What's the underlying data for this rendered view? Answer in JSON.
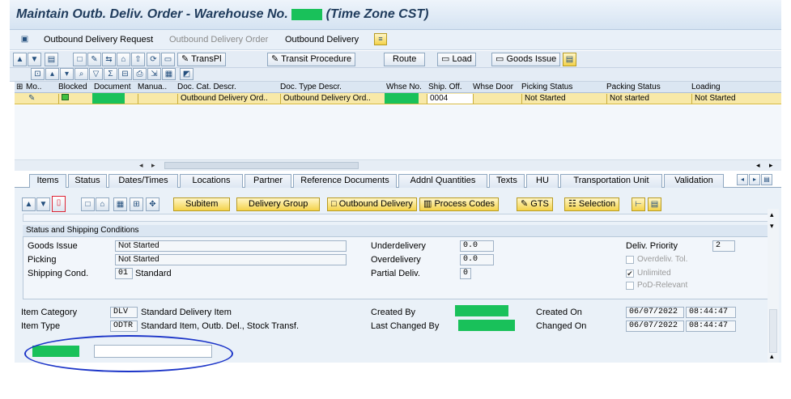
{
  "window": {
    "title_prefix": "Maintain Outb. Deliv. Order - Warehouse No.",
    "title_suffix": "(Time Zone CST)"
  },
  "menu": {
    "items": [
      {
        "label": "Outbound Delivery Request",
        "disabled": false
      },
      {
        "label": "Outbound Delivery Order",
        "disabled": true
      },
      {
        "label": "Outbound Delivery",
        "disabled": false
      }
    ]
  },
  "toolbar": {
    "transpl": "TransPl",
    "transit": "Transit Procedure",
    "route": "Route",
    "load": "Load",
    "goods_issue": "Goods Issue"
  },
  "grid": {
    "columns": [
      "Mo..",
      "Blocked",
      "Document",
      "Manua..",
      "Doc. Cat. Descr.",
      "Doc. Type Descr.",
      "Whse No.",
      "Ship. Off.",
      "Whse Door",
      "Picking Status",
      "Packing Status",
      "Loading"
    ],
    "row": {
      "doc_cat": "Outbound Delivery Ord..",
      "doc_type": "Outbound Delivery Ord..",
      "ship_off": "0004",
      "picking": "Not Started",
      "packing": "Not started",
      "loading": "Not Started"
    }
  },
  "tabs": [
    "Items",
    "Status",
    "Dates/Times",
    "Locations",
    "Partner",
    "Reference Documents",
    "Addnl Quantities",
    "Texts",
    "HU",
    "Transportation Unit",
    "Validation"
  ],
  "item_toolbar": {
    "subitem": "Subitem",
    "delivery_group": "Delivery Group",
    "outbound_delivery": "Outbound Delivery",
    "process_codes": "Process Codes",
    "gts": "GTS",
    "selection": "Selection"
  },
  "section": {
    "title": "Status and Shipping Conditions",
    "goods_issue_label": "Goods Issue",
    "goods_issue_value": "Not Started",
    "picking_label": "Picking",
    "picking_value": "Not Started",
    "shipping_label": "Shipping Cond.",
    "shipping_code": "01",
    "shipping_text": "Standard",
    "underdelivery_label": "Underdelivery",
    "underdelivery_value": "0.0",
    "overdelivery_label": "Overdelivery",
    "overdelivery_value": "0.0",
    "partial_label": "Partial Deliv.",
    "partial_value": "0",
    "priority_label": "Deliv. Priority",
    "priority_value": "2",
    "overdeliv_tol": "Overdeliv. Tol.",
    "unlimited": "Unlimited",
    "pod": "PoD-Relevant"
  },
  "item": {
    "category_label": "Item Category",
    "category_code": "DLV",
    "category_text": "Standard Delivery Item",
    "type_label": "Item Type",
    "type_code": "ODTR",
    "type_text": "Standard Item, Outb. Del., Stock Transf.",
    "created_by_label": "Created By",
    "last_changed_label": "Last Changed By",
    "created_on_label": "Created On",
    "created_on_date": "06/07/2022",
    "created_on_time": "08:44:47",
    "changed_on_label": "Changed On",
    "changed_on_date": "06/07/2022",
    "changed_on_time": "08:44:47"
  },
  "colors": {
    "highlight": "#f8e9a8",
    "mask": "#19c15a",
    "annotation": "#1c35c8"
  }
}
